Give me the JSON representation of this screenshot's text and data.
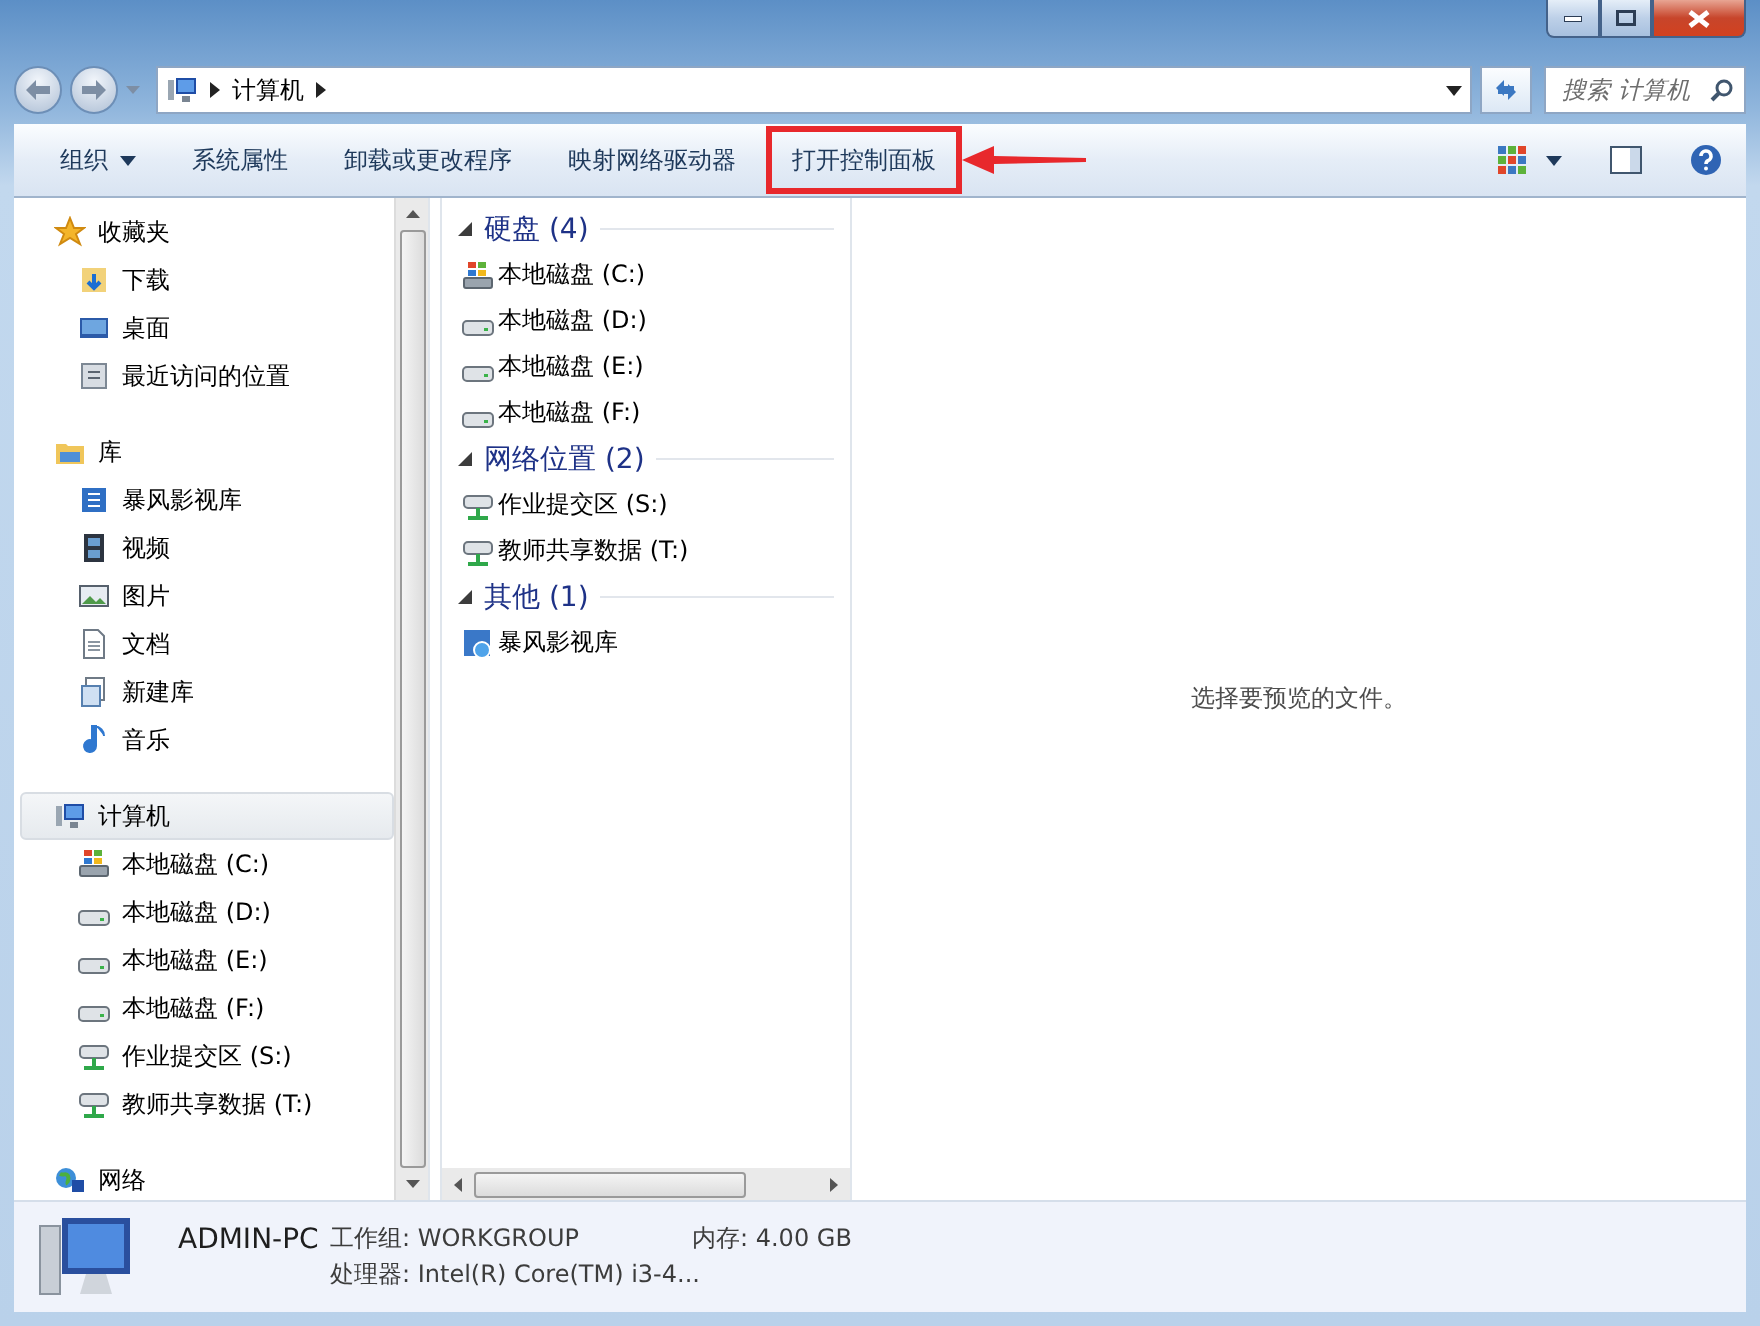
{
  "address": {
    "segments": [
      "计算机"
    ]
  },
  "search": {
    "placeholder": "搜索 计算机"
  },
  "toolbar": [
    {
      "label": "组织",
      "dropdown": true,
      "highlighted": false
    },
    {
      "label": "系统属性",
      "dropdown": false,
      "highlighted": false
    },
    {
      "label": "卸载或更改程序",
      "dropdown": false,
      "highlighted": false
    },
    {
      "label": "映射网络驱动器",
      "dropdown": false,
      "highlighted": false
    },
    {
      "label": "打开控制面板",
      "dropdown": false,
      "highlighted": true
    }
  ],
  "nav": [
    {
      "label": "收藏夹",
      "kind": "star",
      "selected": false,
      "children": [
        {
          "label": "下载",
          "kind": "download",
          "selected": false
        },
        {
          "label": "桌面",
          "kind": "desktop",
          "selected": false
        },
        {
          "label": "最近访问的位置",
          "kind": "recent",
          "selected": false
        }
      ]
    },
    {
      "label": "库",
      "kind": "library",
      "selected": false,
      "children": [
        {
          "label": "暴风影视库",
          "kind": "medialib",
          "selected": false
        },
        {
          "label": "视频",
          "kind": "film",
          "selected": false
        },
        {
          "label": "图片",
          "kind": "image",
          "selected": false
        },
        {
          "label": "文档",
          "kind": "doc",
          "selected": false
        },
        {
          "label": "新建库",
          "kind": "newlib",
          "selected": false
        },
        {
          "label": "音乐",
          "kind": "music",
          "selected": false
        }
      ]
    },
    {
      "label": "计算机",
      "kind": "computer",
      "selected": true,
      "children": [
        {
          "label": "本地磁盘 (C:)",
          "kind": "windrive",
          "selected": false
        },
        {
          "label": "本地磁盘 (D:)",
          "kind": "drive",
          "selected": false
        },
        {
          "label": "本地磁盘 (E:)",
          "kind": "drive",
          "selected": false
        },
        {
          "label": "本地磁盘 (F:)",
          "kind": "drive",
          "selected": false
        },
        {
          "label": "作业提交区 (S:)",
          "kind": "netdrive",
          "selected": false
        },
        {
          "label": "教师共享数据 (T:)",
          "kind": "netdrive",
          "selected": false
        }
      ]
    },
    {
      "label": "网络",
      "kind": "network",
      "selected": false
    }
  ],
  "groups": [
    {
      "title": "硬盘 (4)",
      "expanded": true,
      "items": [
        {
          "label": "本地磁盘 (C:)",
          "kind": "windrive"
        },
        {
          "label": "本地磁盘 (D:)",
          "kind": "drive"
        },
        {
          "label": "本地磁盘 (E:)",
          "kind": "drive"
        },
        {
          "label": "本地磁盘 (F:)",
          "kind": "drive"
        }
      ]
    },
    {
      "title": "网络位置 (2)",
      "expanded": true,
      "items": [
        {
          "label": "作业提交区 (S:)",
          "kind": "netdrive"
        },
        {
          "label": "教师共享数据 (T:)",
          "kind": "netdrive"
        }
      ]
    },
    {
      "title": "其他 (1)",
      "expanded": true,
      "items": [
        {
          "label": "暴风影视库",
          "kind": "mediafile"
        }
      ]
    }
  ],
  "preview": {
    "message": "选择要预览的文件。"
  },
  "details": {
    "name": "ADMIN-PC",
    "workgroup": "工作组: WORKGROUP",
    "memory": "内存: 4.00 GB",
    "processor": "处理器: Intel(R) Core(TM) i3-4..."
  }
}
